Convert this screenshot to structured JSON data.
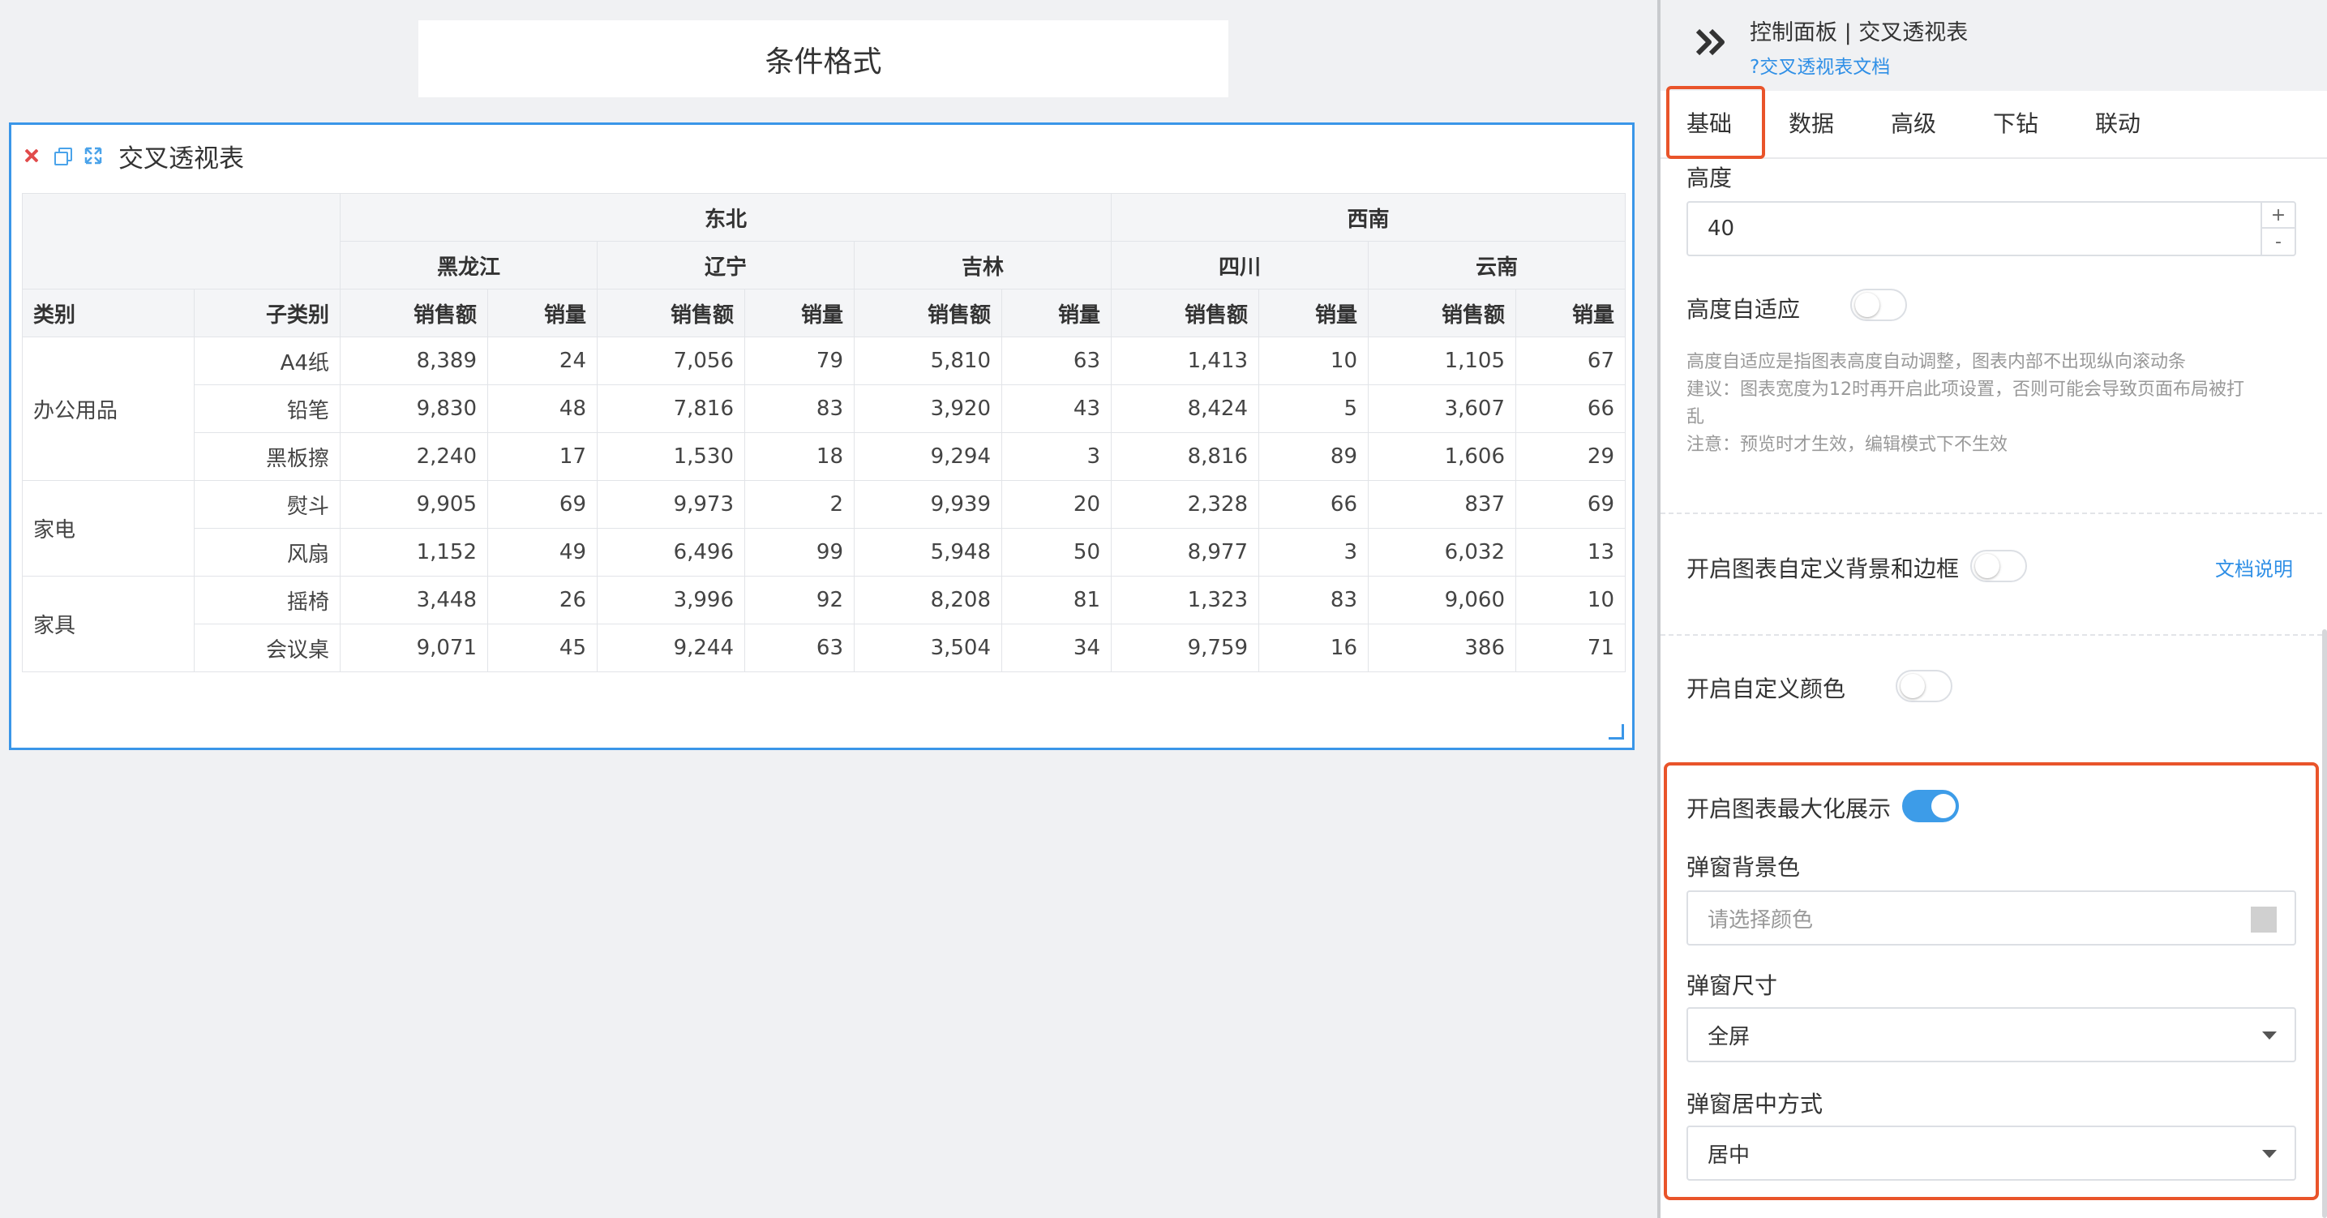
{
  "canvas": {
    "title": "条件格式",
    "widget": {
      "title": "交叉透视表",
      "regions": [
        "东北",
        "西南"
      ],
      "provinces": [
        "黑龙江",
        "辽宁",
        "吉林",
        "四川",
        "云南"
      ],
      "header_category": "类别",
      "header_subcategory": "子类别",
      "metric_sales": "销售额",
      "metric_qty": "销量",
      "rows": [
        {
          "category": "办公用品",
          "sub": "A4纸",
          "values": [
            "8,389",
            "24",
            "7,056",
            "79",
            "5,810",
            "63",
            "1,413",
            "10",
            "1,105",
            "67"
          ]
        },
        {
          "category": "",
          "sub": "铅笔",
          "values": [
            "9,830",
            "48",
            "7,816",
            "83",
            "3,920",
            "43",
            "8,424",
            "5",
            "3,607",
            "66"
          ]
        },
        {
          "category": "",
          "sub": "黑板擦",
          "values": [
            "2,240",
            "17",
            "1,530",
            "18",
            "9,294",
            "3",
            "8,816",
            "89",
            "1,606",
            "29"
          ]
        },
        {
          "category": "家电",
          "sub": "熨斗",
          "values": [
            "9,905",
            "69",
            "9,973",
            "2",
            "9,939",
            "20",
            "2,328",
            "66",
            "837",
            "69"
          ]
        },
        {
          "category": "",
          "sub": "风扇",
          "values": [
            "1,152",
            "49",
            "6,496",
            "99",
            "5,948",
            "50",
            "8,977",
            "3",
            "6,032",
            "13"
          ]
        },
        {
          "category": "家具",
          "sub": "摇椅",
          "values": [
            "3,448",
            "26",
            "3,996",
            "92",
            "8,208",
            "81",
            "1,323",
            "83",
            "9,060",
            "10"
          ]
        },
        {
          "category": "",
          "sub": "会议桌",
          "values": [
            "9,071",
            "45",
            "9,244",
            "63",
            "3,504",
            "34",
            "9,759",
            "16",
            "386",
            "71"
          ]
        }
      ]
    }
  },
  "panel": {
    "title": "控制面板 | 交叉透视表",
    "doc_link": "?交叉透视表文档",
    "tabs": [
      "基础",
      "数据",
      "高级",
      "下钻",
      "联动"
    ],
    "active_tab": "基础",
    "height_label": "高度",
    "height_value": "40",
    "stepper_plus": "+",
    "stepper_minus": "-",
    "auto_height_label": "高度自适应",
    "auto_height_on": false,
    "auto_height_hint_1": "高度自适应是指图表高度自动调整，图表内部不出现纵向滚动条",
    "auto_height_hint_2": "建议：图表宽度为12时再开启此项设置，否则可能会导致页面布局被打",
    "auto_height_hint_3": "乱",
    "auto_height_hint_4": "注意：预览时才生效，编辑模式下不生效",
    "custom_bg_label": "开启图表自定义背景和边框",
    "custom_bg_on": false,
    "custom_bg_doc": "文档说明",
    "custom_color_label": "开启自定义颜色",
    "custom_color_on": false,
    "maximize_label": "开启图表最大化展示",
    "maximize_on": true,
    "popup_bg_label": "弹窗背景色",
    "popup_bg_placeholder": "请选择颜色",
    "popup_size_label": "弹窗尺寸",
    "popup_size_value": "全屏",
    "popup_center_label": "弹窗居中方式",
    "popup_center_value": "居中"
  },
  "colors": {
    "accent": "#3a96e8",
    "highlight": "#e9542a",
    "close": "#e14b4b"
  },
  "icons": [
    "close-icon",
    "copy-icon",
    "expand-icon",
    "collapse-panel-icon",
    "help-icon",
    "color-swatch-icon",
    "caret-down-icon"
  ]
}
